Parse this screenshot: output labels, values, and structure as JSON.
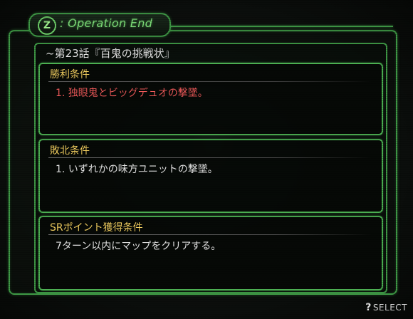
{
  "header": {
    "icon_glyph": "Z",
    "icon_name": "z-emblem-icon",
    "title": ": Operation End"
  },
  "chapter": {
    "title": "~第23話『百鬼の挑戦状』"
  },
  "conditions": [
    {
      "heading": "勝利条件",
      "line": "1. 独眼鬼とビッグデュオの撃墜。",
      "color": "#f05a5a"
    },
    {
      "heading": "敗北条件",
      "line": "1. いずれかの味方ユニットの撃墜。",
      "color": "#e6e6e6"
    },
    {
      "heading": "SRポイント獲得条件",
      "line": "7ターン以内にマップをクリアする。",
      "color": "#e6e6e6"
    }
  ],
  "footer": {
    "hint_glyph": "?",
    "hint_label": "SELECT"
  },
  "colors": {
    "frame_green": "#3f9a46",
    "heading_yellow": "#f4d060",
    "win_red": "#f05a5a"
  }
}
